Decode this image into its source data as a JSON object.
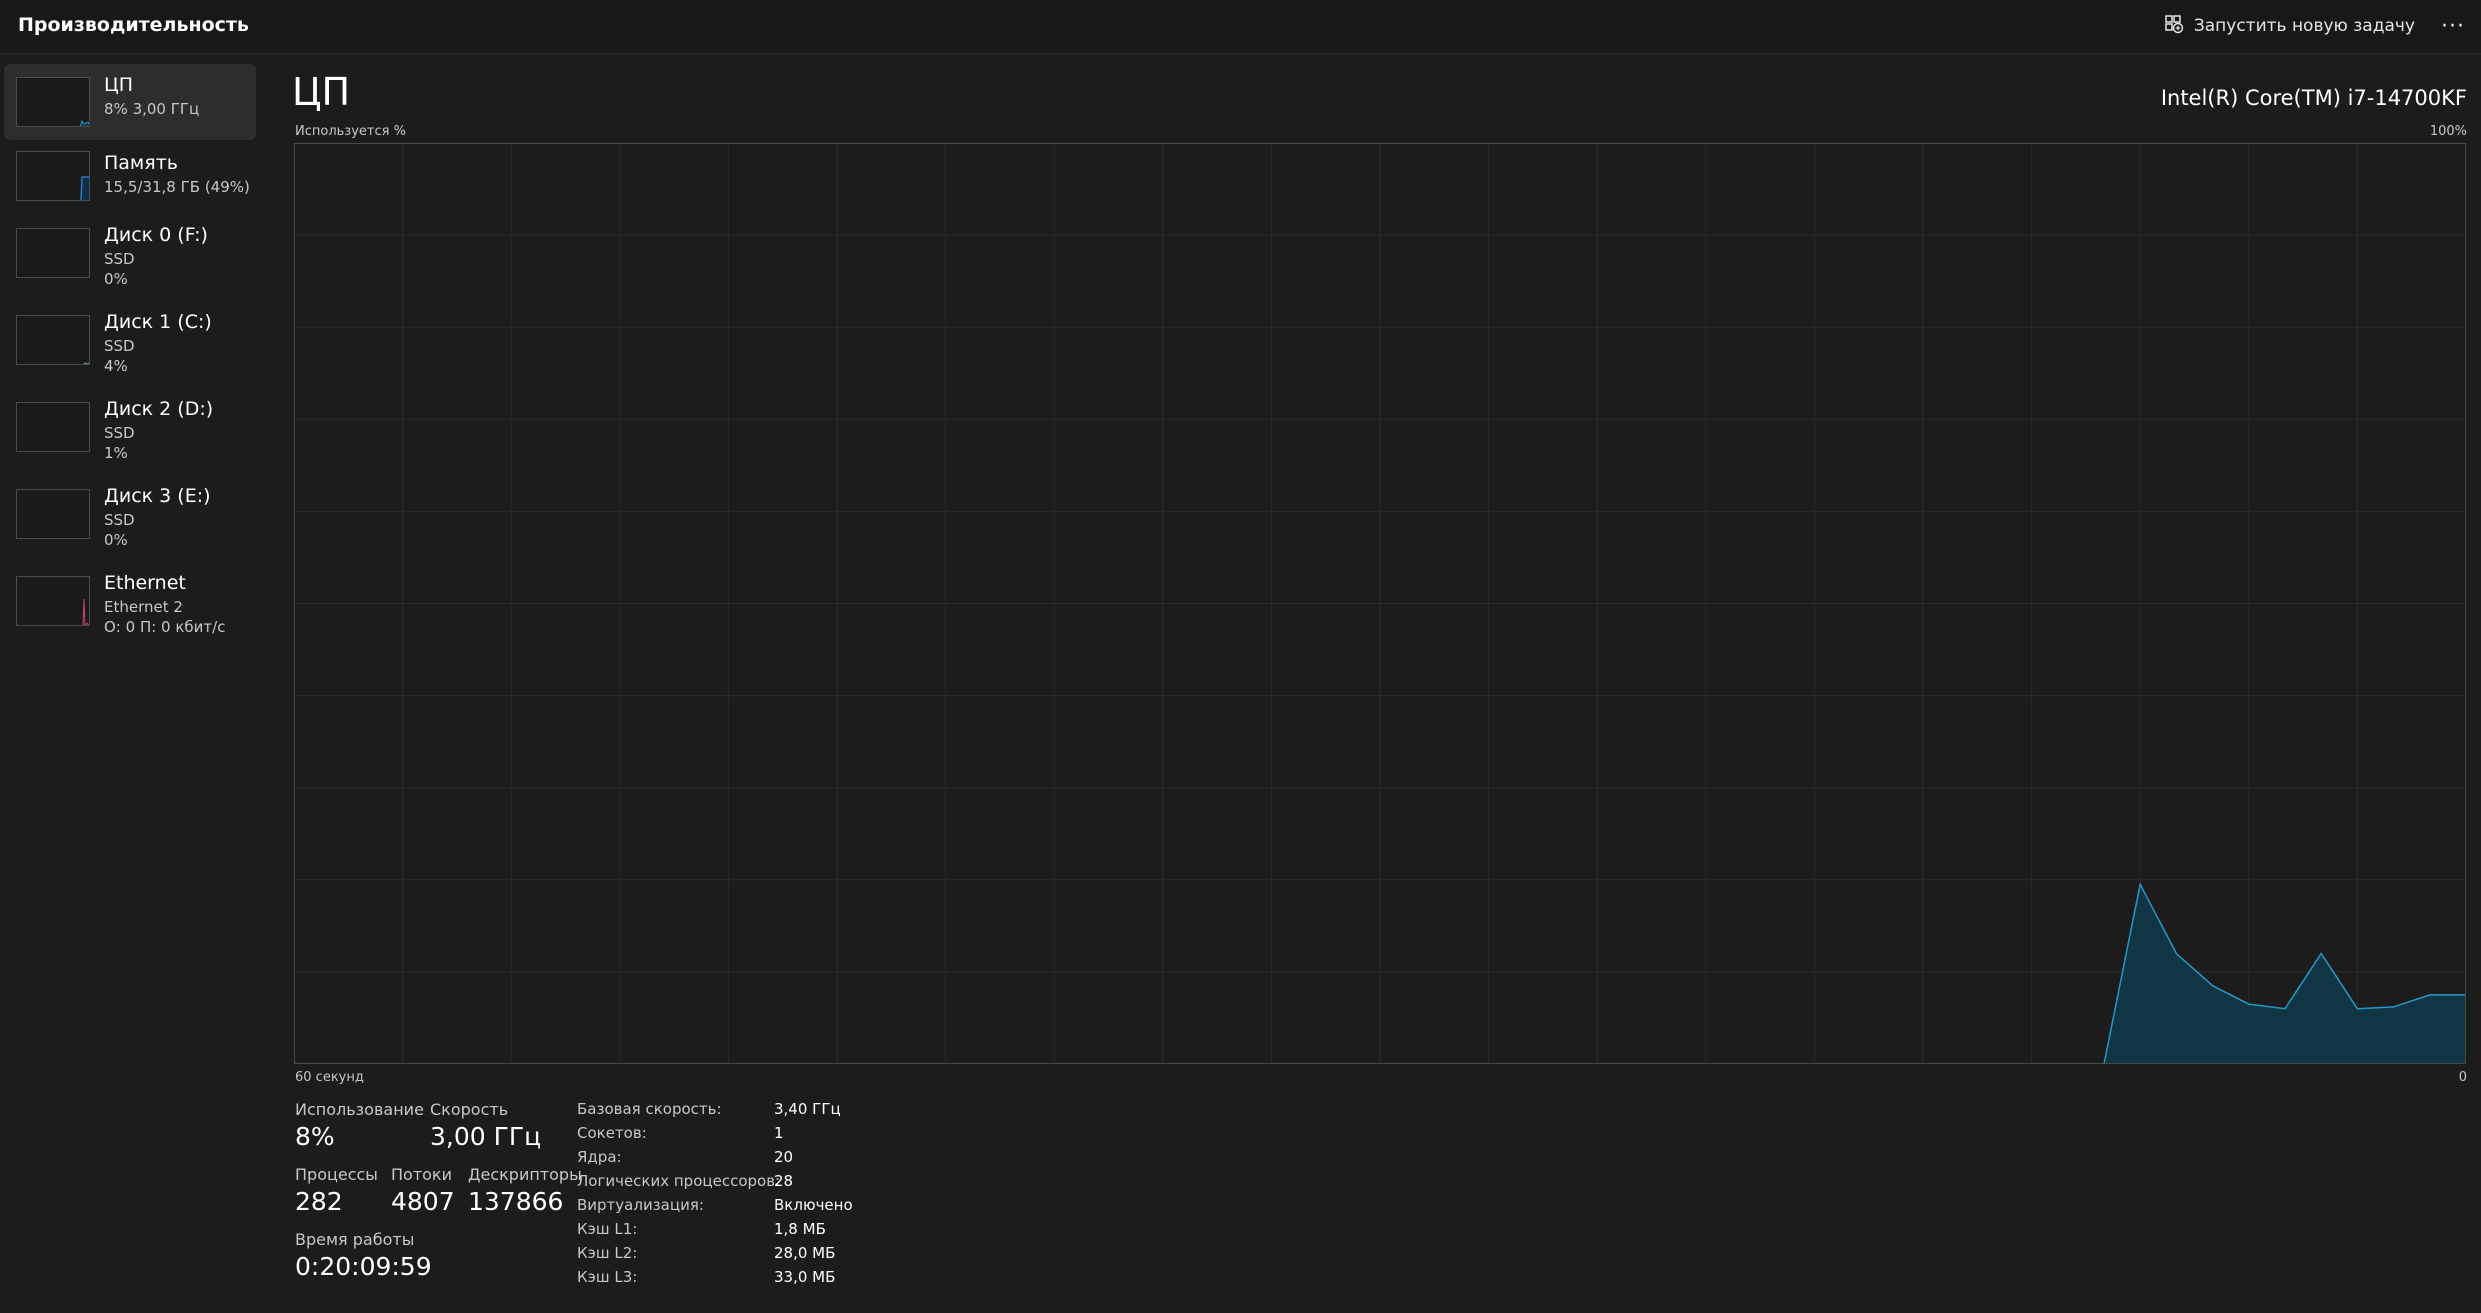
{
  "app": {
    "title": "Производительность"
  },
  "toolbar": {
    "run_task_label": "Запустить новую задачу",
    "more_label": "···"
  },
  "sidebar": {
    "items": [
      {
        "title": "ЦП",
        "line1": "8%  3,00 ГГц",
        "line2": ""
      },
      {
        "title": "Память",
        "line1": "15,5/31,8 ГБ (49%)",
        "line2": ""
      },
      {
        "title": "Диск 0 (F:)",
        "line1": "SSD",
        "line2": "0%"
      },
      {
        "title": "Диск 1 (C:)",
        "line1": "SSD",
        "line2": "4%"
      },
      {
        "title": "Диск 2 (D:)",
        "line1": "SSD",
        "line2": "1%"
      },
      {
        "title": "Диск 3 (E:)",
        "line1": "SSD",
        "line2": "0%"
      },
      {
        "title": "Ethernet",
        "line1": "Ethernet 2",
        "line2": "О: 0 П: 0 кбит/с"
      }
    ]
  },
  "main": {
    "title": "ЦП",
    "cpu_name": "Intel(R) Core(TM) i7-14700KF"
  },
  "chart_data": {
    "type": "area",
    "ylabel": "Используется %",
    "y_max_label": "100%",
    "xlabel": "60 секунд",
    "x_min_label": "0",
    "ylim": [
      0,
      100
    ],
    "xlim": [
      60,
      0
    ],
    "grid": true,
    "x": [
      10,
      9,
      8,
      7,
      6,
      5,
      4,
      3,
      2,
      1,
      0
    ],
    "values": [
      0,
      19.5,
      12,
      8.5,
      6.5,
      6,
      12,
      6,
      6.2,
      7.5,
      7.5
    ],
    "colors": {
      "line": "#2996c8",
      "fill": "#0f3a4a",
      "grid": "#2b2b2b",
      "border": "#4a4a4a"
    }
  },
  "stats": {
    "usage_label": "Использование",
    "usage_value": "8%",
    "speed_label": "Скорость",
    "speed_value": "3,00 ГГц",
    "processes_label": "Процессы",
    "processes_value": "282",
    "threads_label": "Потоки",
    "threads_value": "4807",
    "handles_label": "Дескрипторы",
    "handles_value": "137866",
    "uptime_label": "Время работы",
    "uptime_value": "0:20:09:59"
  },
  "specs": [
    {
      "label": "Базовая скорость:",
      "value": "3,40 ГГц"
    },
    {
      "label": "Сокетов:",
      "value": "1"
    },
    {
      "label": "Ядра:",
      "value": "20"
    },
    {
      "label": "Логических процессоров:",
      "value": "28"
    },
    {
      "label": "Виртуализация:",
      "value": "Включено"
    },
    {
      "label": "Кэш L1:",
      "value": "1,8 МБ"
    },
    {
      "label": "Кэш L2:",
      "value": "28,0 МБ"
    },
    {
      "label": "Кэш L3:",
      "value": "33,0 МБ"
    }
  ]
}
